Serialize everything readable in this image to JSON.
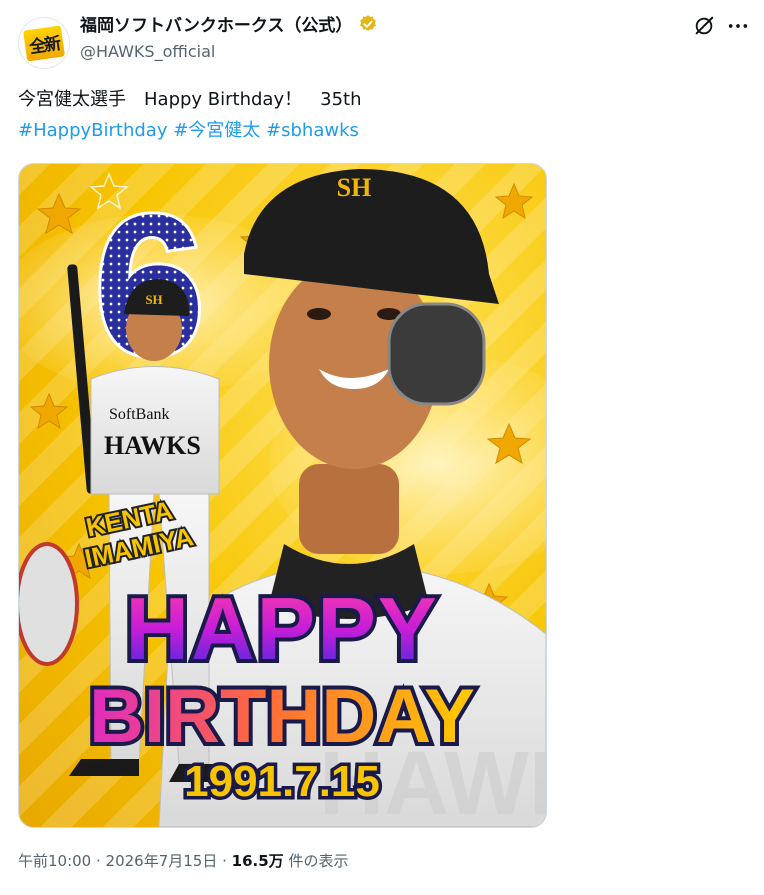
{
  "account": {
    "display_name": "福岡ソフトバンクホークス（公式）",
    "handle": "@HAWKS_official",
    "avatar_text": "全新"
  },
  "tweet": {
    "text_line1": "今宮健太選手　Happy Birthday！　35th",
    "hashtags": [
      "#HappyBirthday",
      "#今宮健太",
      "#sbhawks"
    ]
  },
  "image": {
    "jersey_number": "6",
    "player_name_line1": "KENTA",
    "player_name_line2": "IMAMIYA",
    "happy": "HAPPY",
    "birthday": "BIRTHDAY",
    "date": "1991.7.15",
    "cap_logo": "SH",
    "uniform_text_1": "SoftBank",
    "uniform_text_2": "HAWKS",
    "background_watermark": "HAWKS"
  },
  "footer": {
    "time": "午前10:00",
    "sep1": " · ",
    "date": "2026年7月15日",
    "sep2": " · ",
    "views": "16.5万",
    "views_label": " 件の表示"
  },
  "colors": {
    "link": "#1d9bf0",
    "verified_badge": "#e2b719",
    "muted": "#536471",
    "banner_yellow": "#f7c400"
  },
  "icons": [
    "verified-badge-icon",
    "grok-icon",
    "more-icon"
  ]
}
